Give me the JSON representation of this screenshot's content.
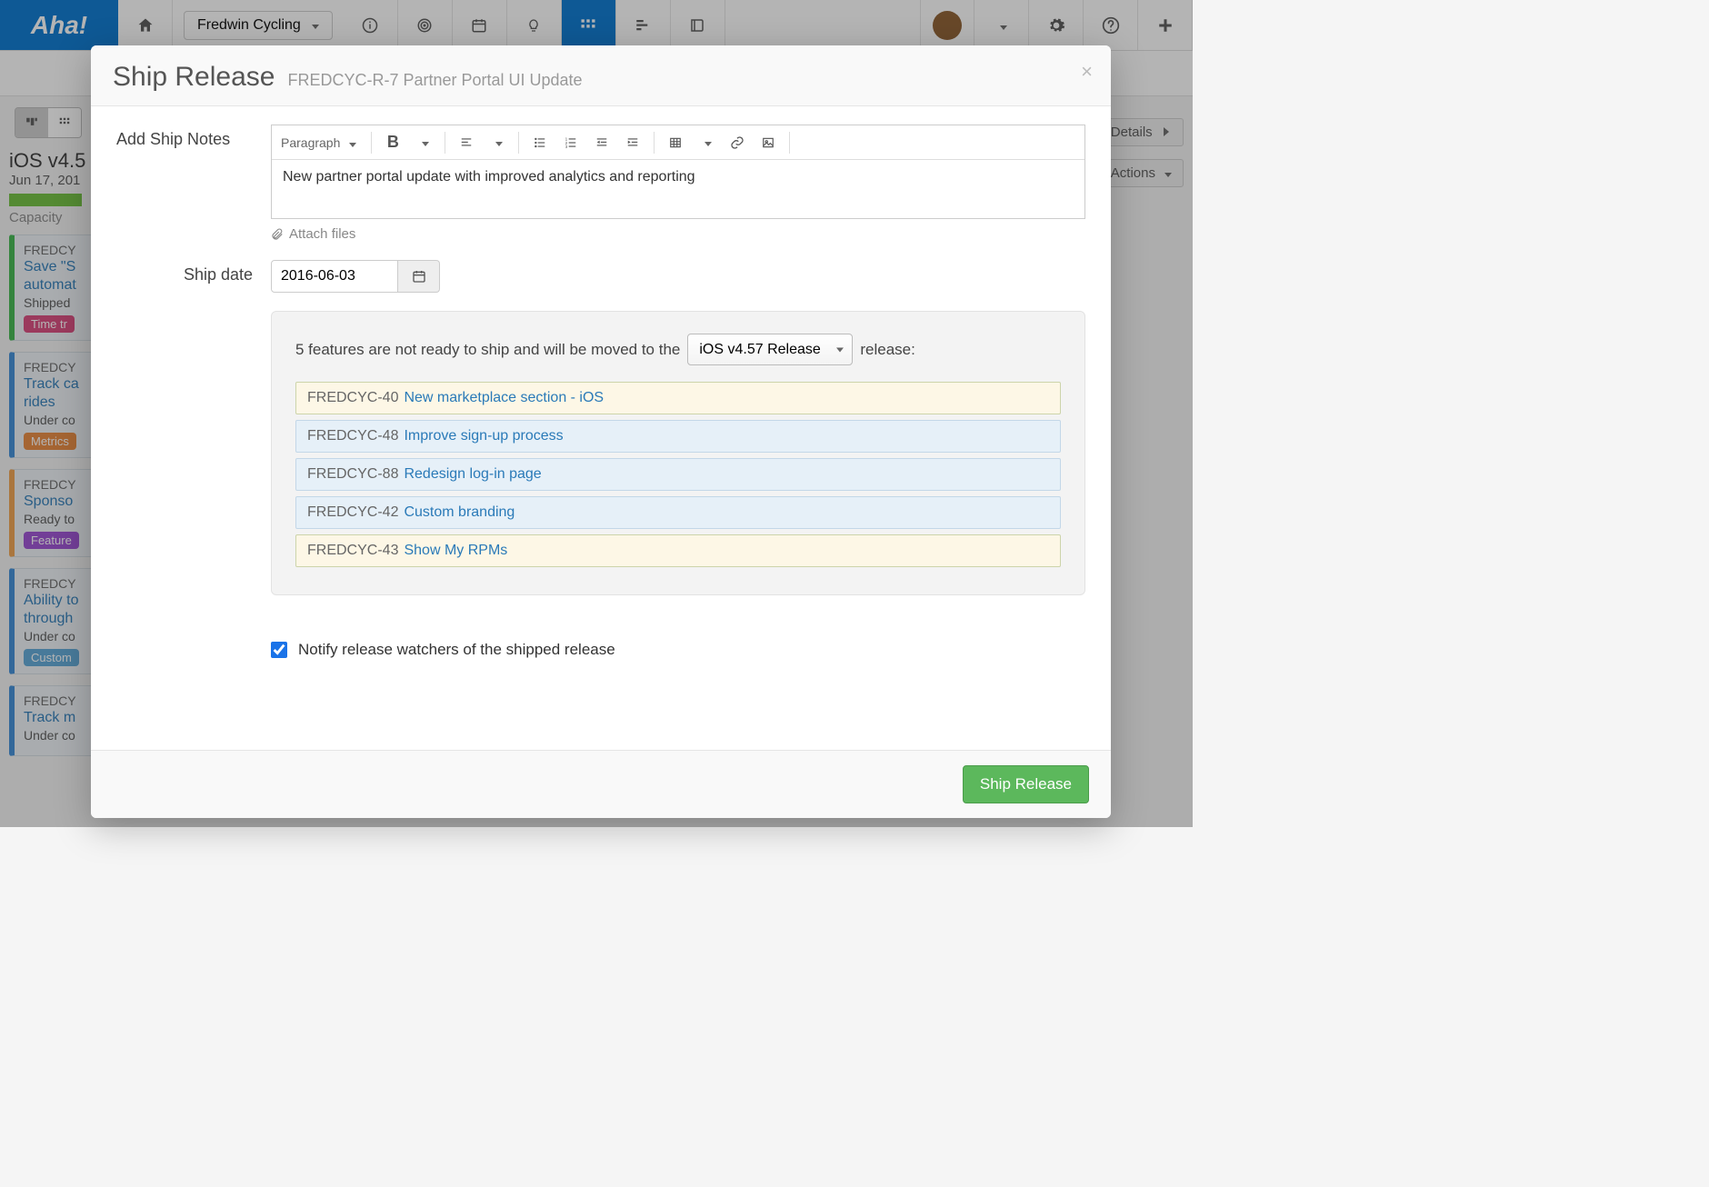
{
  "nav": {
    "logo": "Aha!",
    "product": "Fredwin Cycling"
  },
  "right_stubs": {
    "details": "Details",
    "actions": "Actions"
  },
  "bg": {
    "release_title": "iOS v4.5",
    "release_date": "Jun 17, 201",
    "capacity": "Capacity",
    "cards": [
      {
        "id": "FREDCY",
        "title": "Save \"S",
        "title2": "automat",
        "status": "Shipped",
        "tag": "Time tr",
        "tag_color": "pink",
        "border": "green"
      },
      {
        "id": "FREDCY",
        "title": "Track ca",
        "title2": "rides",
        "status": "Under co",
        "tag": "Metrics",
        "tag_color": "orange",
        "border": "blue"
      },
      {
        "id": "FREDCY",
        "title": "Sponso",
        "title2": "",
        "status": "Ready to",
        "tag": "Feature",
        "tag_color": "purple",
        "border": "orange"
      },
      {
        "id": "FREDCY",
        "title": "Ability to",
        "title2": "through",
        "status": "Under co",
        "tag": "Custom",
        "tag_color": "blue",
        "border": "blue"
      },
      {
        "id": "FREDCY",
        "title": "Track m",
        "title2": "",
        "status": "Under co",
        "tag": "",
        "tag_color": "",
        "border": "blue"
      }
    ]
  },
  "modal": {
    "title": "Ship Release",
    "subtitle": "FREDCYC-R-7 Partner Portal UI Update",
    "notes_label": "Add Ship Notes",
    "paragraph_selector": "Paragraph",
    "notes_body": "New partner portal update with improved analytics and reporting",
    "attach_label": "Attach files",
    "ship_date_label": "Ship date",
    "ship_date_value": "2016-06-03",
    "not_ready_prefix": "5 features are not ready to ship and will be moved to the",
    "not_ready_suffix": "release:",
    "target_release": "iOS v4.57 Release",
    "features": [
      {
        "id": "FREDCYC-40",
        "name": "New marketplace section - iOS",
        "style": "cream"
      },
      {
        "id": "FREDCYC-48",
        "name": "Improve sign-up process",
        "style": "blueish"
      },
      {
        "id": "FREDCYC-88",
        "name": "Redesign log-in page",
        "style": "blueish"
      },
      {
        "id": "FREDCYC-42",
        "name": "Custom branding",
        "style": "blueish"
      },
      {
        "id": "FREDCYC-43",
        "name": "Show My RPMs",
        "style": "cream"
      }
    ],
    "notify_label": "Notify release watchers of the shipped release",
    "notify_checked": true,
    "submit_label": "Ship Release"
  }
}
